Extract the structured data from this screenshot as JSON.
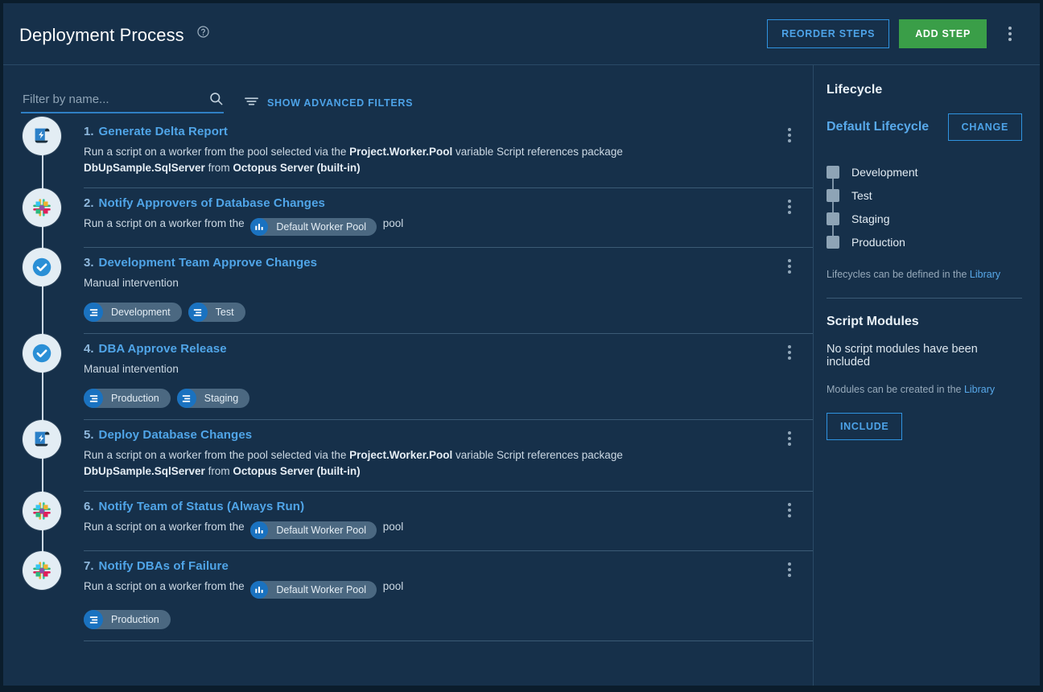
{
  "header": {
    "title": "Deployment Process",
    "help_icon": "help-circle-icon",
    "reorder_label": "REORDER STEPS",
    "add_step_label": "ADD STEP",
    "overflow_icon": "vertical-dots-icon"
  },
  "filterbar": {
    "search_placeholder": "Filter by name...",
    "search_value": "",
    "search_icon": "search-icon",
    "advanced_filters_label": "SHOW ADVANCED FILTERS",
    "advanced_filters_icon": "filter-icon"
  },
  "steps": [
    {
      "number": "1.",
      "name": "Generate Delta Report",
      "icon": "script-scroll-icon",
      "desc_html": "Run a script on a worker from the pool selected via the <b>Project.Worker.Pool</b> variable Script references package <b>DbUpSample.SqlServer</b> from <b>Octopus Server (built-in)</b>",
      "pool": null,
      "tags": []
    },
    {
      "number": "2.",
      "name": "Notify Approvers of Database Changes",
      "icon": "slack-icon",
      "desc_prefix": "Run a script on a worker from the",
      "desc_suffix": "pool",
      "pool": "Default Worker Pool",
      "pool_icon": "bar-chart-icon",
      "tags": []
    },
    {
      "number": "3.",
      "name": "Development Team Approve Changes",
      "icon": "check-circle-icon",
      "desc_html": "Manual intervention",
      "pool": null,
      "tags": [
        "Development",
        "Test"
      ]
    },
    {
      "number": "4.",
      "name": "DBA Approve Release",
      "icon": "check-circle-icon",
      "desc_html": "Manual intervention",
      "pool": null,
      "tags": [
        "Production",
        "Staging"
      ]
    },
    {
      "number": "5.",
      "name": "Deploy Database Changes",
      "icon": "script-scroll-icon",
      "desc_html": "Run a script on a worker from the pool selected via the <b>Project.Worker.Pool</b> variable Script references package <b>DbUpSample.SqlServer</b> from <b>Octopus Server (built-in)</b>",
      "pool": null,
      "tags": []
    },
    {
      "number": "6.",
      "name": "Notify Team of Status (Always Run)",
      "icon": "slack-icon",
      "desc_prefix": "Run a script on a worker from the",
      "desc_suffix": "pool",
      "pool": "Default Worker Pool",
      "pool_icon": "bar-chart-icon",
      "tags": []
    },
    {
      "number": "7.",
      "name": "Notify DBAs of Failure",
      "icon": "slack-icon",
      "desc_prefix": "Run a script on a worker from the",
      "desc_suffix": "pool",
      "pool": "Default Worker Pool",
      "pool_icon": "bar-chart-icon",
      "tags": [
        "Production"
      ]
    }
  ],
  "sidebar": {
    "lifecycle_heading": "Lifecycle",
    "lifecycle_name": "Default Lifecycle",
    "change_label": "CHANGE",
    "phases": [
      "Development",
      "Test",
      "Staging",
      "Production"
    ],
    "lifecycle_hint_text": "Lifecycles can be defined in the ",
    "lifecycle_hint_link": "Library",
    "script_modules_heading": "Script Modules",
    "script_modules_empty": "No script modules have been included",
    "script_modules_hint_text": "Modules can be created in the ",
    "script_modules_hint_link": "Library",
    "include_label": "INCLUDE"
  },
  "colors": {
    "page_bg": "#0b1d2c",
    "panel_bg": "#16304a",
    "accent_blue": "#2f93e0",
    "link_blue": "#50a5e8",
    "green": "#3a9e48",
    "divider": "#3b5a75",
    "tag_bg": "#4b6881",
    "tag_circle": "#1a72c0"
  }
}
